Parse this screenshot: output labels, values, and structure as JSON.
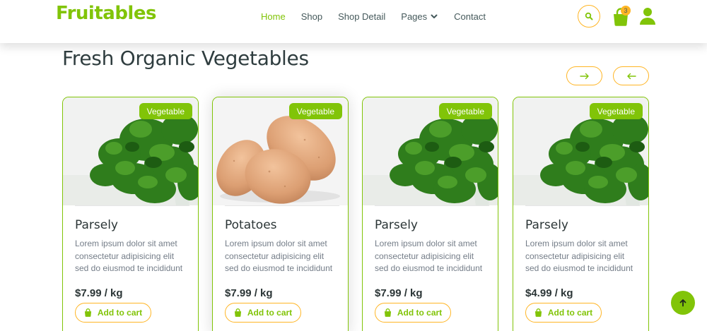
{
  "header": {
    "brand": "Fruitables",
    "nav": [
      {
        "label": "Home",
        "active": true
      },
      {
        "label": "Shop"
      },
      {
        "label": "Shop Detail"
      },
      {
        "label": "Pages"
      },
      {
        "label": "Contact"
      }
    ],
    "cart_count": "3",
    "icons": [
      "search-icon",
      "shopping-bag-icon",
      "user-icon"
    ]
  },
  "section": {
    "title": "Fresh Organic Vegetables"
  },
  "products": [
    {
      "category": "Vegetable",
      "name": "Parsely",
      "description": "Lorem ipsum dolor sit amet consectetur adipisicing elit sed do eiusmod te incididunt",
      "price": "$7.99 / kg",
      "button": "Add to cart",
      "image": "parsley"
    },
    {
      "category": "Vegetable",
      "name": "Potatoes",
      "description": "Lorem ipsum dolor sit amet consectetur adipisicing elit sed do eiusmod te incididunt",
      "price": "$7.99 / kg",
      "button": "Add to cart",
      "image": "potatoes"
    },
    {
      "category": "Vegetable",
      "name": "Parsely",
      "description": "Lorem ipsum dolor sit amet consectetur adipisicing elit sed do eiusmod te incididunt",
      "price": "$7.99 / kg",
      "button": "Add to cart",
      "image": "parsley"
    },
    {
      "category": "Vegetable",
      "name": "Parsely",
      "description": "Lorem ipsum dolor sit amet consectetur adipisicing elit sed do eiusmod te incididunt",
      "price": "$4.99 / kg",
      "button": "Add to cart",
      "image": "parsley"
    }
  ],
  "colors": {
    "primary": "#81c408",
    "secondary": "#ffb524",
    "dark": "#45595b"
  }
}
